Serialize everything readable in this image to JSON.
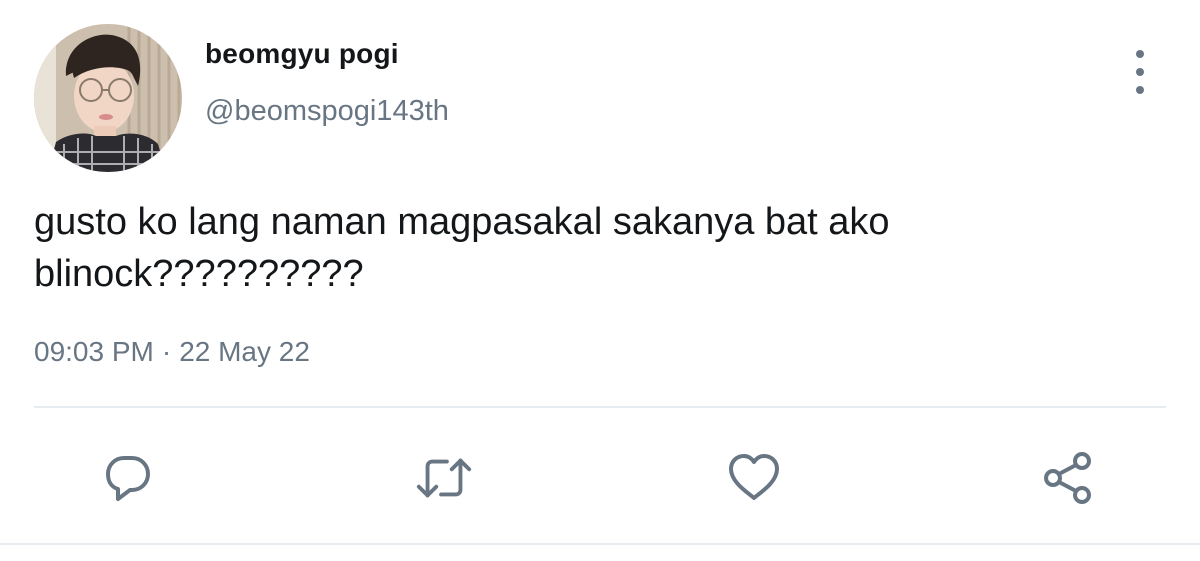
{
  "user": {
    "display_name": "beomgyu pogi",
    "handle": "@beomspogi143th",
    "avatar_icon": "profile-photo"
  },
  "tweet": {
    "text": "gusto ko lang naman magpasakal sakanya bat ako blinock??????????",
    "time": "09:03 PM",
    "separator": "·",
    "date": "22 May 22"
  },
  "actions": {
    "reply_icon": "reply-icon",
    "retweet_icon": "retweet-icon",
    "like_icon": "heart-icon",
    "share_icon": "share-icon",
    "more_icon": "more-vertical-icon"
  },
  "colors": {
    "text_primary": "#14171a",
    "text_secondary": "#687684",
    "divider": "#e6ecf0"
  }
}
